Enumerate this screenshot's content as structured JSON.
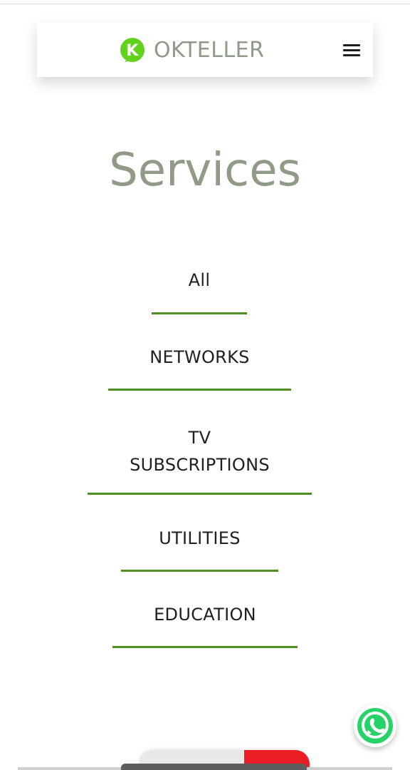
{
  "header": {
    "brand_name": "OKTELLER",
    "logo_letter": "K",
    "menu_icon": "hamburger-menu-icon",
    "brand_color": "#8f9a87",
    "logo_color": "#62d21c"
  },
  "main": {
    "title": "Services",
    "filters": [
      {
        "label": "All"
      },
      {
        "label": "NETWORKS"
      },
      {
        "label_line_1": "TV",
        "label_line_2": "SUBSCRIPTIONS"
      },
      {
        "label": "UTILITIES"
      },
      {
        "label": "EDUCATION"
      }
    ],
    "underline_color": "#4f8f22"
  },
  "floating": {
    "whatsapp_icon": "whatsapp-icon"
  }
}
